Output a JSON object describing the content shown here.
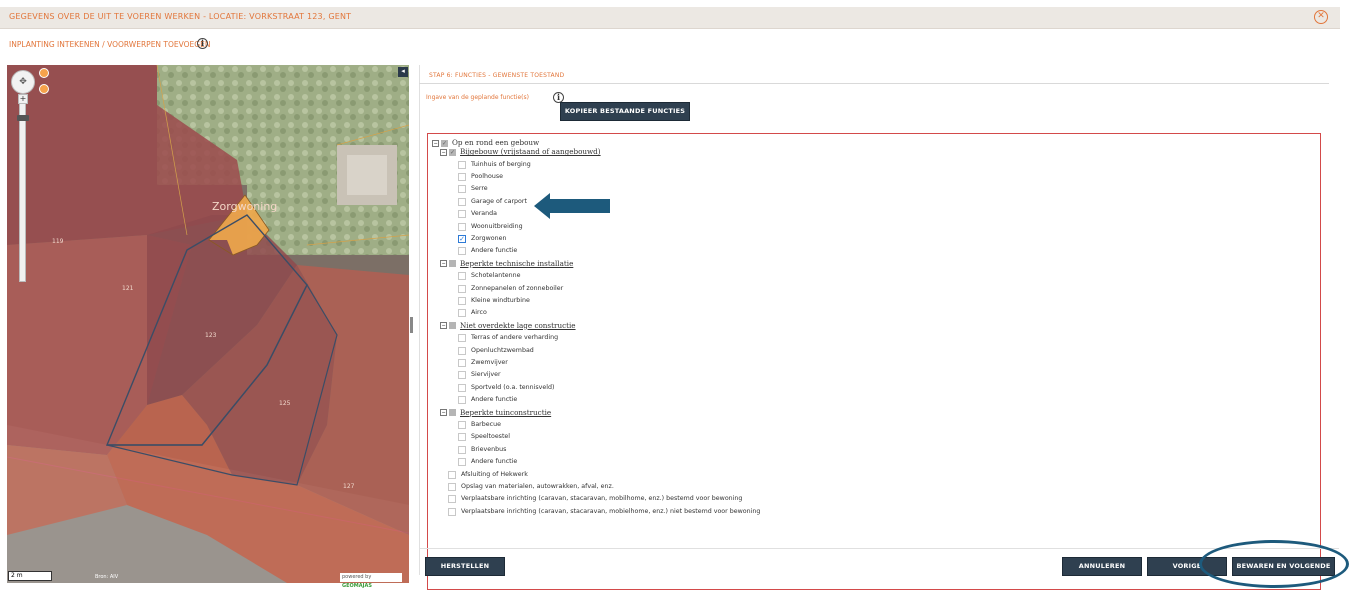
{
  "window": {
    "title": "GEGEVENS OVER DE UIT TE VOEREN WERKEN - LOCATIE: VORKSTRAAT 123, GENT",
    "close_glyph": "✕"
  },
  "subtitle": "INPLANTING INTEKENEN / VOORWERPEN TOEVOEGEN",
  "info_glyph": "i",
  "map": {
    "label_zorgwoning": "Zorgwoning",
    "house_numbers": [
      "119",
      "121",
      "123",
      "125",
      "127"
    ],
    "scale": "2 m",
    "source": "Bron: AIV",
    "powered_by": "powered by",
    "powered_brand": "GEOMAJAS",
    "collapse_glyph": "◂",
    "zoom_plus": "+",
    "pan_glyph": "✥"
  },
  "panel": {
    "step_title": "STAP 6: FUNCTIES - GEWENSTE TOESTAND",
    "ingave_label": "Ingave van de geplande functie(s)",
    "copy_button": "KOPIEER BESTAANDE FUNCTIES"
  },
  "tree": [
    {
      "label": "Op en rond een gebouw",
      "kind": "top"
    },
    {
      "label": "Bijgebouw (vrijstaand of aangebouwd)",
      "kind": "group"
    },
    {
      "label": "Tuinhuis of berging",
      "kind": "item",
      "checked": false
    },
    {
      "label": "Poolhouse",
      "kind": "item",
      "checked": false
    },
    {
      "label": "Serre",
      "kind": "item",
      "checked": false
    },
    {
      "label": "Garage of carport",
      "kind": "item",
      "checked": false
    },
    {
      "label": "Veranda",
      "kind": "item",
      "checked": false
    },
    {
      "label": "Woonuitbreiding",
      "kind": "item",
      "checked": false
    },
    {
      "label": "Zorgwonen",
      "kind": "item",
      "checked": true
    },
    {
      "label": "Andere functie",
      "kind": "item",
      "checked": false
    },
    {
      "label": "Beperkte technische installatie",
      "kind": "group"
    },
    {
      "label": "Schotelantenne",
      "kind": "item",
      "checked": false
    },
    {
      "label": "Zonnepanelen of zonneboiler",
      "kind": "item",
      "checked": false
    },
    {
      "label": "Kleine windturbine",
      "kind": "item",
      "checked": false
    },
    {
      "label": "Airco",
      "kind": "item",
      "checked": false
    },
    {
      "label": "Niet overdekte lage constructie",
      "kind": "group"
    },
    {
      "label": "Terras of andere verharding",
      "kind": "item",
      "checked": false
    },
    {
      "label": "Openluchtzwembad",
      "kind": "item",
      "checked": false
    },
    {
      "label": "Zwemvijver",
      "kind": "item",
      "checked": false
    },
    {
      "label": "Siervijver",
      "kind": "item",
      "checked": false
    },
    {
      "label": "Sportveld (o.a. tennisveld)",
      "kind": "item",
      "checked": false
    },
    {
      "label": "Andere functie",
      "kind": "item",
      "checked": false
    },
    {
      "label": "Beperkte tuinconstructie",
      "kind": "group"
    },
    {
      "label": "Barbecue",
      "kind": "item",
      "checked": false
    },
    {
      "label": "Speeltoestel",
      "kind": "item",
      "checked": false
    },
    {
      "label": "Brievenbus",
      "kind": "item",
      "checked": false
    },
    {
      "label": "Andere functie",
      "kind": "item",
      "checked": false
    },
    {
      "label": "Afsluiting of Hekwerk",
      "kind": "root",
      "checked": false
    },
    {
      "label": "Opslag van materialen, autowrakken, afval, enz.",
      "kind": "root",
      "checked": false
    },
    {
      "label": "Verplaatsbare inrichting (caravan, stacaravan, mobilhome, enz.) bestemd voor bewoning",
      "kind": "root",
      "checked": false
    },
    {
      "label": "Verplaatsbare inrichting (caravan, stacaravan, mobielhome, enz.) niet bestemd voor bewoning",
      "kind": "root",
      "checked": false
    }
  ],
  "buttons": {
    "herstellen": "HERSTELLEN",
    "annuleren": "ANNULEREN",
    "vorige": "VORIGE",
    "bewaren": "BEWAREN EN VOLGENDE"
  },
  "colors": {
    "accent_orange": "#e2763b",
    "button_dark": "#2f4050",
    "annotation_blue": "#1d5a7c",
    "tree_border": "#d34a4a"
  }
}
